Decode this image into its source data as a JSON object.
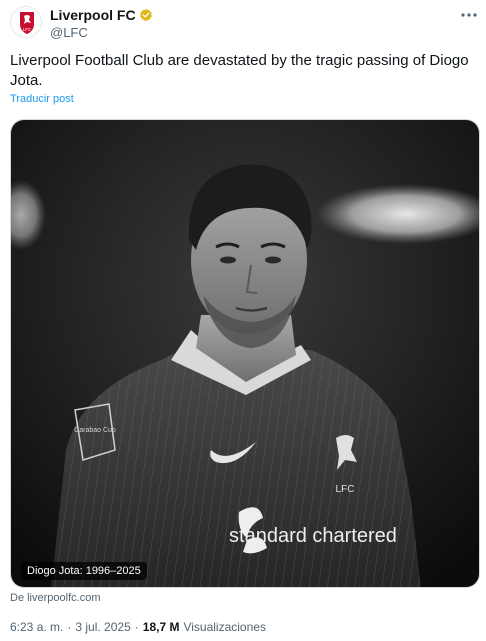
{
  "account": {
    "display_name": "Liverpool FC",
    "handle": "@LFC",
    "avatar_icon": "liverbird-crest-icon",
    "verified_icon": "verified-badge-icon",
    "verified_color": "#e2b719",
    "avatar_text": "LFC"
  },
  "tweet": {
    "text": "Liverpool Football Club are devastated by the tragic passing of Diogo Jota.",
    "translate_label": "Traducir post"
  },
  "media": {
    "caption": "Diogo Jota: 1996–2025",
    "sponsor": "standard chartered",
    "competition": "Carabao Cup"
  },
  "source": "De liverpoolfc.com",
  "meta": {
    "time": "6:23 a. m.",
    "separator": "·",
    "date": "3 jul. 2025",
    "views_count": "18,7 M",
    "views_label": "Visualizaciones"
  },
  "colors": {
    "link": "#1d9bf0",
    "secondary_text": "#536471",
    "lfc_red": "#c8102e"
  }
}
